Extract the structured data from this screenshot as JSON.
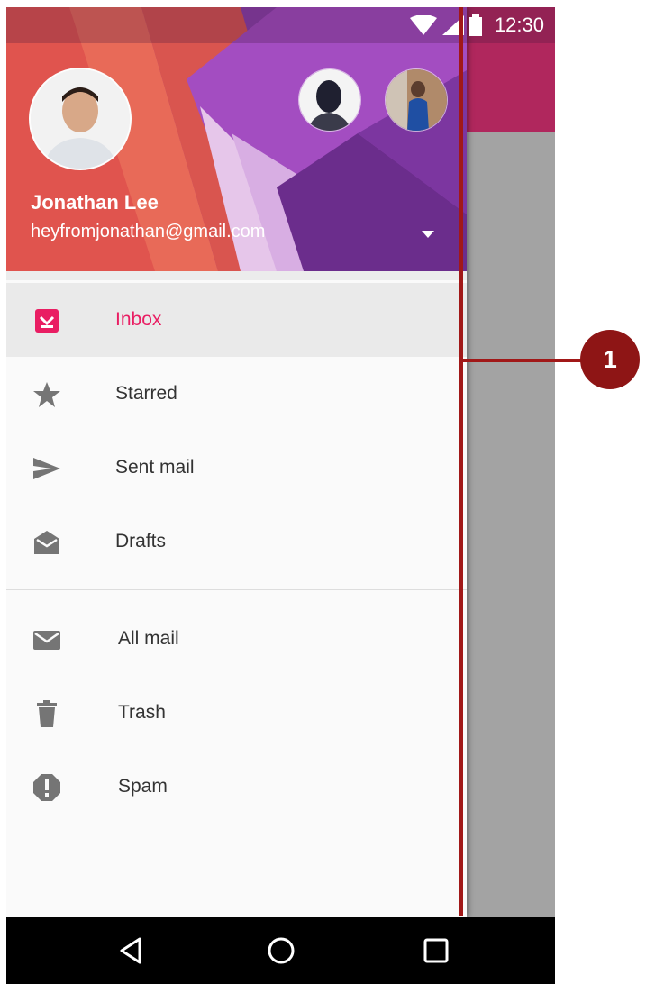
{
  "status_bar": {
    "time": "12:30",
    "icons": [
      "wifi-icon",
      "signal-icon",
      "battery-icon"
    ]
  },
  "account": {
    "name": "Jonathan Lee",
    "email": "heyfromjonathan@gmail.com",
    "other_accounts": [
      "avatar-account-2",
      "avatar-account-3"
    ]
  },
  "menu": {
    "primary": [
      {
        "label": "Inbox",
        "icon": "inbox-icon",
        "active": true
      },
      {
        "label": "Starred",
        "icon": "star-icon"
      },
      {
        "label": "Sent mail",
        "icon": "send-icon"
      },
      {
        "label": "Drafts",
        "icon": "drafts-icon"
      }
    ],
    "secondary": [
      {
        "label": "All mail",
        "icon": "mail-icon"
      },
      {
        "label": "Trash",
        "icon": "trash-icon"
      },
      {
        "label": "Spam",
        "icon": "spam-icon"
      }
    ]
  },
  "annotation": {
    "label": "1"
  },
  "nav_bar": {
    "buttons": [
      "back-icon",
      "home-icon",
      "recents-icon"
    ]
  },
  "colors": {
    "accent": "#e91e63",
    "toolbar": "#b0275d",
    "annotation": "#8e1515",
    "icon_gray": "#757575"
  }
}
